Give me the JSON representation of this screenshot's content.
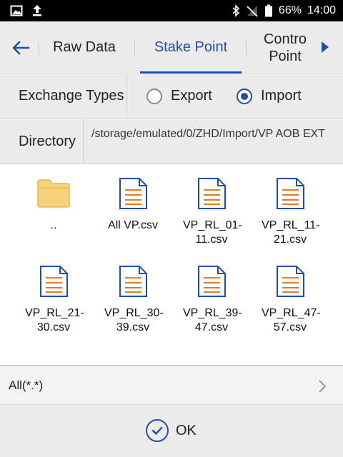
{
  "status_bar": {
    "battery": "66%",
    "time": "14:00",
    "icons": [
      "image-icon",
      "upload-icon",
      "bluetooth-icon",
      "no-signal-icon",
      "battery-icon"
    ]
  },
  "tabs": [
    {
      "label": "Raw Data",
      "active": false
    },
    {
      "label": "Stake Point",
      "active": true
    },
    {
      "label": "Contro Point",
      "active": false
    }
  ],
  "exchange": {
    "label": "Exchange Types",
    "options": [
      {
        "label": "Export",
        "checked": false
      },
      {
        "label": "Import",
        "checked": true
      }
    ]
  },
  "directory": {
    "label": "Directory",
    "path": "/storage/emulated/0/ZHD/Import/VP AOB EXT"
  },
  "files": [
    {
      "name": "..",
      "type": "folder"
    },
    {
      "name": "All VP.csv",
      "type": "csv"
    },
    {
      "name": "VP_RL_01-11.csv",
      "type": "csv"
    },
    {
      "name": "VP_RL_11-21.csv",
      "type": "csv"
    },
    {
      "name": "VP_RL_21-30.csv",
      "type": "csv"
    },
    {
      "name": "VP_RL_30-39.csv",
      "type": "csv"
    },
    {
      "name": "VP_RL_39-47.csv",
      "type": "csv"
    },
    {
      "name": "VP_RL_47-57.csv",
      "type": "csv"
    }
  ],
  "filter": {
    "label": "All(*.*)"
  },
  "ok": {
    "label": "OK"
  },
  "colors": {
    "accent": "#1f4fa8",
    "doc_lines": "#e8792b",
    "folder": "#f6d27a"
  }
}
